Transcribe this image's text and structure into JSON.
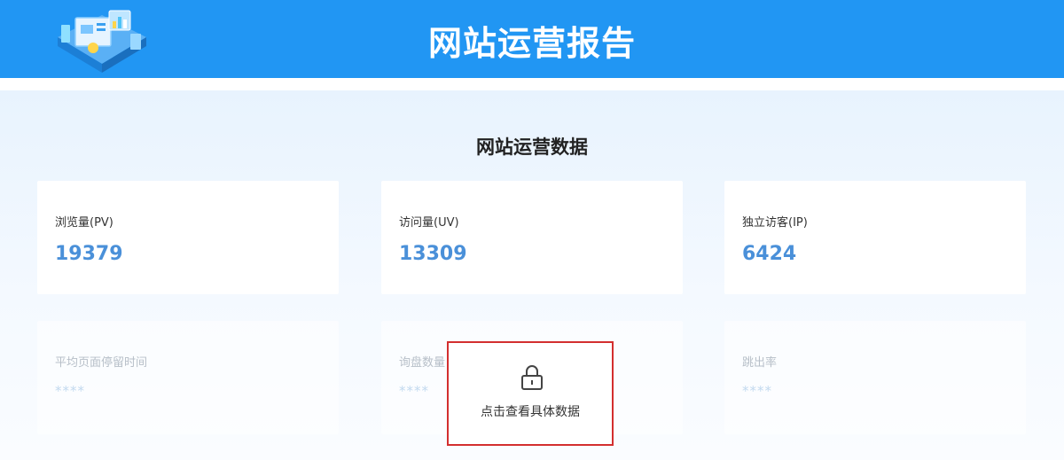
{
  "header": {
    "title": "网站运营报告",
    "logo_icon": "analytics-dashboard-illustration"
  },
  "section": {
    "title": "网站运营数据"
  },
  "stats": [
    {
      "label": "浏览量(PV)",
      "value": "19379"
    },
    {
      "label": "访问量(UV)",
      "value": "13309"
    },
    {
      "label": "独立访客(IP)",
      "value": "6424"
    }
  ],
  "locked_stats": [
    {
      "label": "平均页面停留时间",
      "value": "****"
    },
    {
      "label": "询盘数量",
      "value": "****"
    },
    {
      "label": "跳出率",
      "value": "****"
    }
  ],
  "unlock": {
    "icon": "lock-icon",
    "label": "点击查看具体数据",
    "border_color": "#d32f2f"
  },
  "colors": {
    "header": "#2196f3",
    "value": "#4a90d9"
  }
}
